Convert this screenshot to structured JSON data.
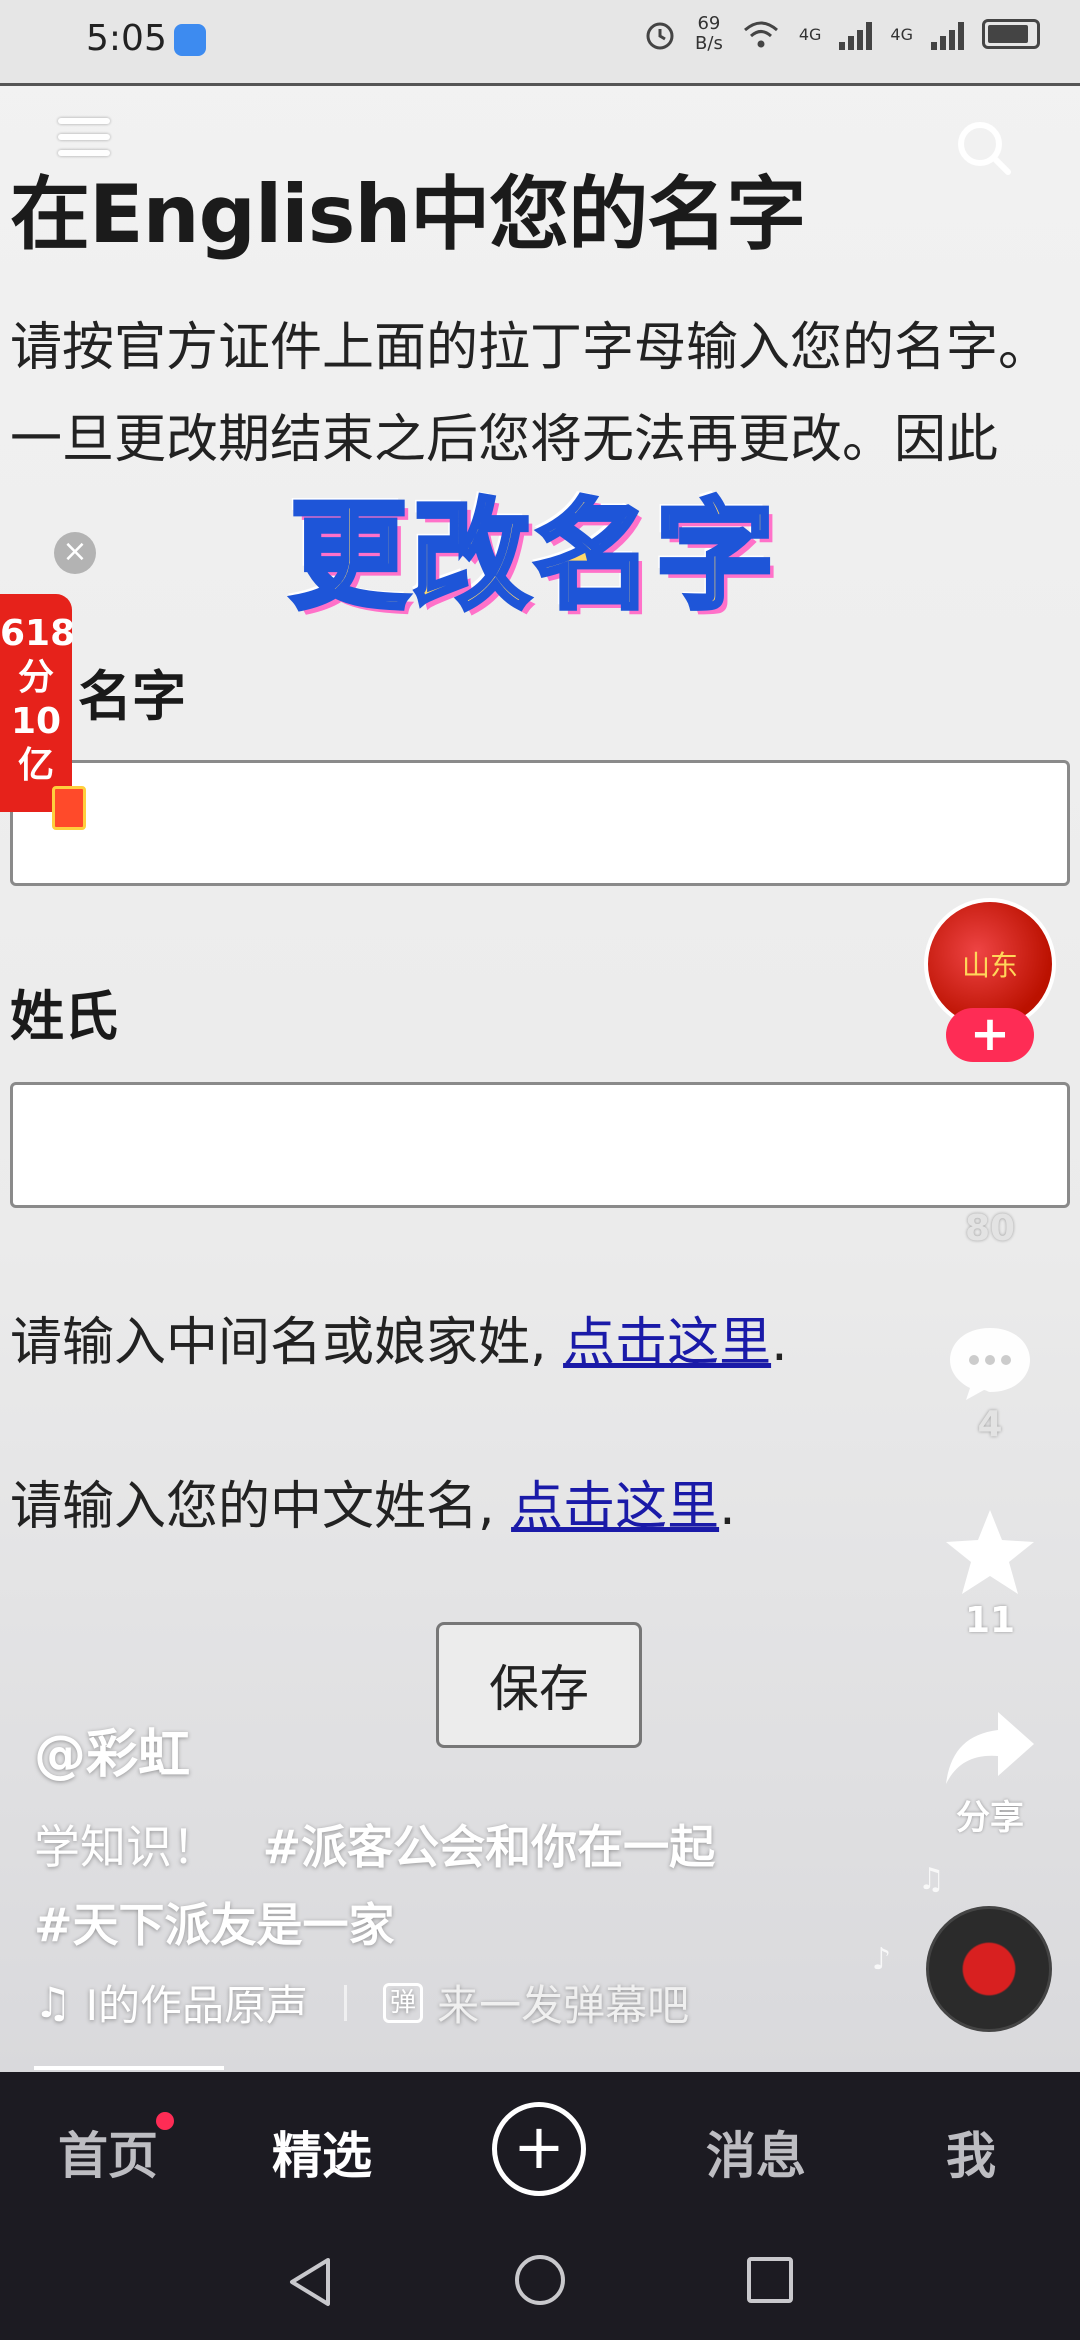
{
  "status_bar": {
    "time": "5:05",
    "net_speed_value": "69",
    "net_speed_unit": "B/s",
    "signal_label_1": "4G",
    "signal_label_2": "4G"
  },
  "video": {
    "heading": "在English中您的名字",
    "paragraph": "请按官方证件上面的拉丁字母输入您的名字。 一旦更改期结束之后您将无法再更改。因此",
    "sticker_text": "更改名字",
    "first_name_label": "名字",
    "last_name_label": "姓氏",
    "middle_name_text": "请输入中间名或娘家姓, ",
    "middle_name_link": "点击这里",
    "chinese_name_text": "请输入您的中文姓名, ",
    "chinese_name_link": "点击这里",
    "period": ".",
    "save_button": "保存"
  },
  "promo": {
    "line1": "618",
    "line2": "分",
    "line3": "10",
    "line4": "亿",
    "close": "×"
  },
  "avatar": {
    "text": "山东",
    "follow": "+"
  },
  "right_rail": {
    "likes": "80",
    "comments": "4",
    "favorites": "11",
    "share": "分享"
  },
  "caption": {
    "author": "@彩虹",
    "text": "学知识！",
    "tag1": "#派客公会和你在一起",
    "tag2": "#天下派友是一家",
    "music": "I的作品原声",
    "danmaku": "来一发弹幕吧",
    "danmaku_icon_glyph": "弹"
  },
  "bottom_nav": {
    "home": "首页",
    "featured": "精选",
    "add": "+",
    "messages": "消息",
    "me": "我"
  },
  "colors": {
    "accent": "#fe2c55",
    "nav_bg": "#1c1b22",
    "link": "#1a1aa8"
  }
}
